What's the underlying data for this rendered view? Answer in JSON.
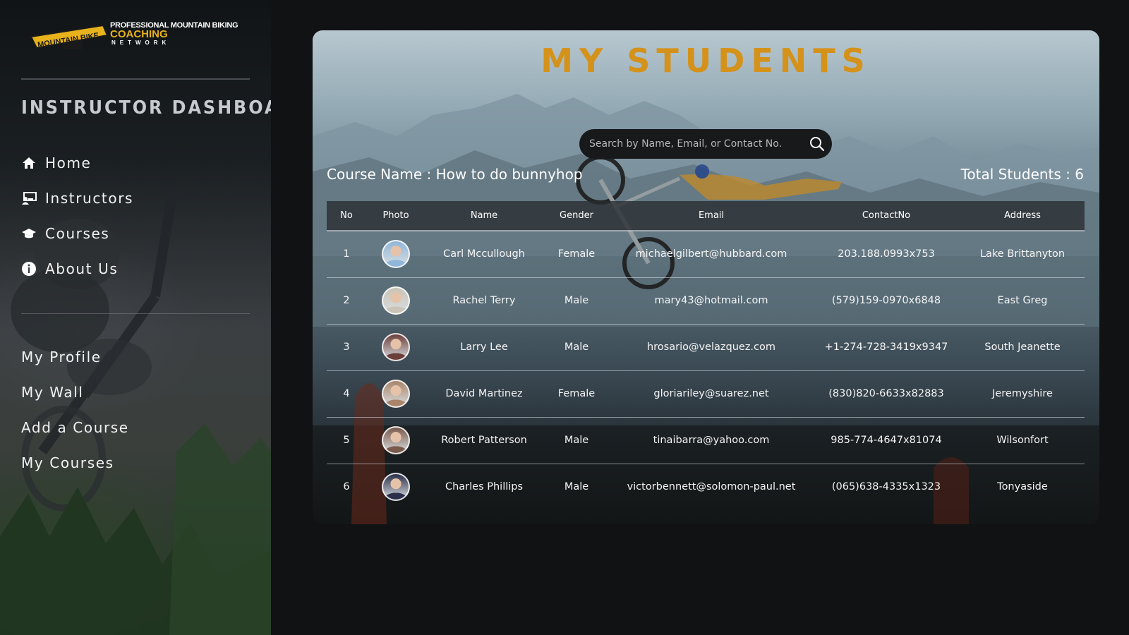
{
  "brand": {
    "logo_plate_text": "MOUNTAIN BIKE",
    "line1": "PROFESSIONAL MOUNTAIN BIKING",
    "line2": "COACHING",
    "line3": "NETWORK",
    "accent_color": "#d4921a"
  },
  "sidebar": {
    "title": "INSTRUCTOR DASHBOARD",
    "nav": [
      {
        "label": "Home",
        "icon": "home-icon"
      },
      {
        "label": "Instructors",
        "icon": "instructor-icon"
      },
      {
        "label": "Courses",
        "icon": "graduation-cap-icon"
      },
      {
        "label": "About Us",
        "icon": "info-icon"
      }
    ],
    "account_links": [
      {
        "label": "My Profile"
      },
      {
        "label": "My Wall"
      },
      {
        "label": "Add a Course"
      },
      {
        "label": "My Courses"
      }
    ]
  },
  "main": {
    "title": "MY STUDENTS",
    "search": {
      "placeholder": "Search by Name, Email, or Contact No.",
      "value": "",
      "icon": "search-icon"
    },
    "course_name": "Course Name : How to do bunnyhop",
    "total_students": "Total Students : 6",
    "table": {
      "headers": [
        "No",
        "Photo",
        "Name",
        "Gender",
        "Email",
        "ContactNo",
        "Address"
      ],
      "rows": [
        {
          "no": "1",
          "name": "Carl Mccullough",
          "gender": "Female",
          "email": "michaelgilbert@hubbard.com",
          "contact": "203.188.0993x753",
          "address": "Lake Brittanyton",
          "avatar_color": "#8fb6d9"
        },
        {
          "no": "2",
          "name": "Rachel Terry",
          "gender": "Male",
          "email": "mary43@hotmail.com",
          "contact": "(579)159-0970x6848",
          "address": "East Greg",
          "avatar_color": "#c9c3b8"
        },
        {
          "no": "3",
          "name": "Larry Lee",
          "gender": "Male",
          "email": "hrosario@velazquez.com",
          "contact": "+1-274-728-3419x9347",
          "address": "South Jeanette",
          "avatar_color": "#6b3f3a"
        },
        {
          "no": "4",
          "name": "David Martinez",
          "gender": "Female",
          "email": "gloriariley@suarez.net",
          "contact": "(830)820-6633x82883",
          "address": "Jeremyshire",
          "avatar_color": "#a8846a"
        },
        {
          "no": "5",
          "name": "Robert Patterson",
          "gender": "Male",
          "email": "tinaibarra@yahoo.com",
          "contact": "985-774-4647x81074",
          "address": "Wilsonfort",
          "avatar_color": "#7a5a4c"
        },
        {
          "no": "6",
          "name": "Charles Phillips",
          "gender": "Male",
          "email": "victorbennett@solomon-paul.net",
          "contact": "(065)638-4335x1323",
          "address": "Tonyaside",
          "avatar_color": "#2b2f4a"
        }
      ]
    }
  }
}
